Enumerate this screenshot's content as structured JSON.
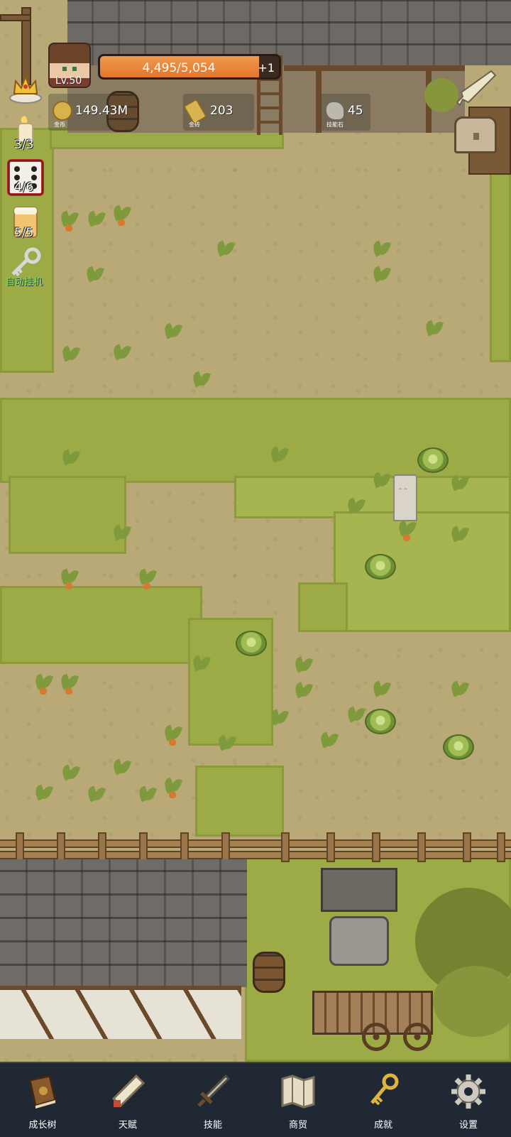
{
  "player": {
    "level": "Lv.50",
    "xp_text": "4,495/5,054",
    "xp_fraction": 0.889,
    "xp_bonus": "+1"
  },
  "resources": [
    {
      "value": "149.43M",
      "caption": "金币",
      "icon": "gold-coin-icon",
      "color": "#d8b24a"
    },
    {
      "value": "203",
      "caption": "金砖",
      "icon": "gold-bar-icon",
      "color": "#d9b352"
    },
    {
      "value": "45",
      "caption": "技能石",
      "icon": "skill-stone-icon",
      "color": "#bdb8ad"
    }
  ],
  "side": {
    "candle_count": "3/3",
    "dice_count": "4/6",
    "beer_count": "5/5",
    "auto_label": "自动挂机"
  },
  "nav": [
    {
      "label": "成长树",
      "icon": "book-icon"
    },
    {
      "label": "天赋",
      "icon": "scroll-icon"
    },
    {
      "label": "技能",
      "icon": "sword-icon"
    },
    {
      "label": "商贸",
      "icon": "map-icon"
    },
    {
      "label": "成就",
      "icon": "key-icon"
    },
    {
      "label": "设置",
      "icon": "gear-icon"
    }
  ]
}
